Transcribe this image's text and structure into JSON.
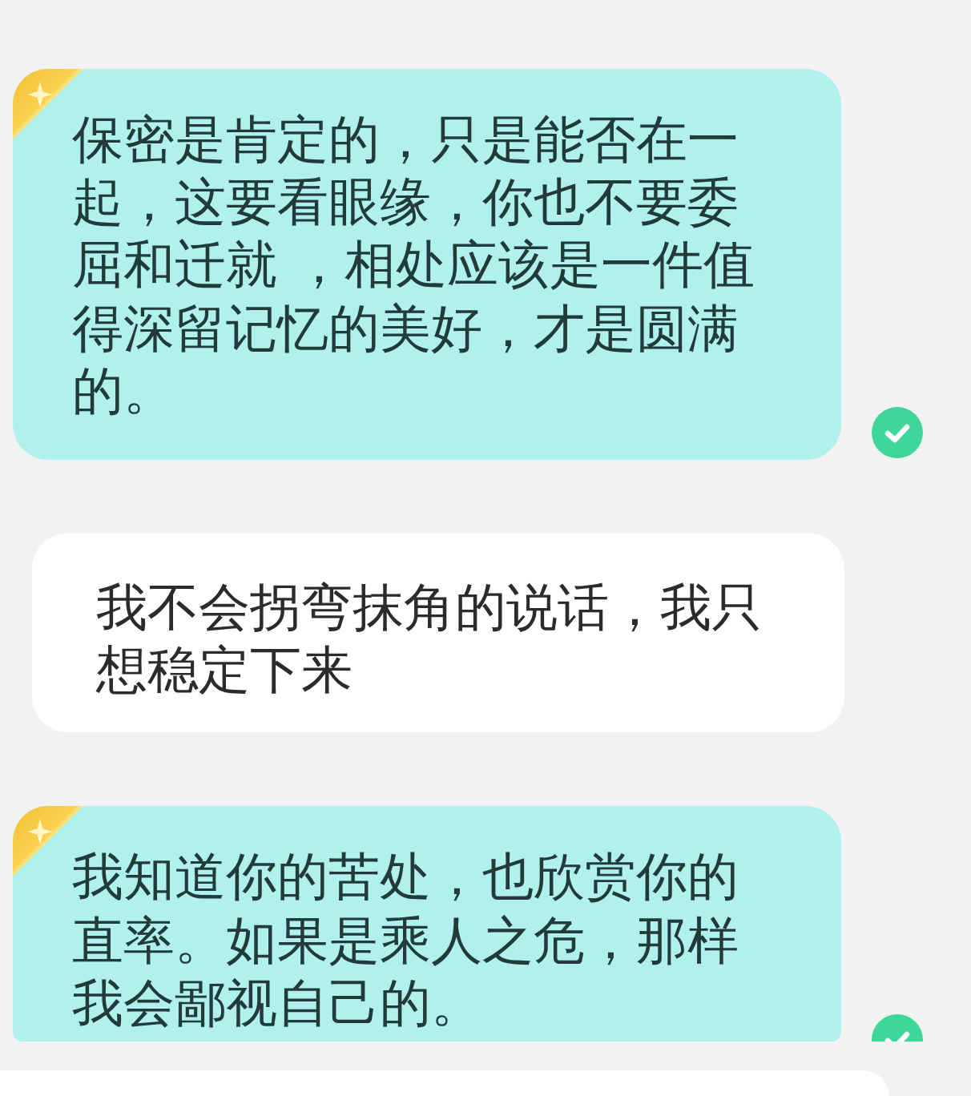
{
  "messages": [
    {
      "kind": "sent",
      "text": "保密是肯定的，只是能否在一起，这要看眼缘，你也不要委屈和迁就 ，相处应该是一件值得深留记忆的美好，才是圆满的。",
      "read": true
    },
    {
      "kind": "received",
      "text": "我不会拐弯抹角的说话，我只想稳定下来"
    },
    {
      "kind": "sent",
      "text": "我知道你的苦处，也欣赏你的直率。如果是乘人之危，那样我会鄙视自己的。",
      "read": true
    },
    {
      "kind": "received"
    }
  ]
}
